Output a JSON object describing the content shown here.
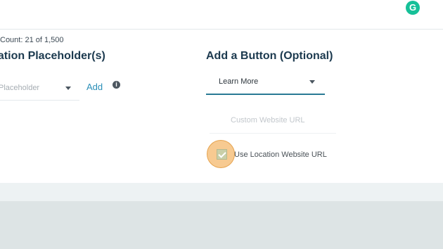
{
  "header": {
    "grammarly_icon": "grammarly-g-icon",
    "grammarly_letter": "G"
  },
  "content": {
    "char_count": "Count: 21 of 1,500",
    "location_title": "cation Placeholder(s)",
    "location_placeholder": "Placeholder",
    "add_label": "Add",
    "info_icon": "info-icon",
    "button_title": "Add a Button (Optional)",
    "button_select_value": "Learn More",
    "url_placeholder": "Custom Website URL",
    "use_location_label": "Use Location Website URL",
    "use_location_checked": true
  },
  "colors": {
    "accent": "#2a7a94",
    "title": "#1c3a4f",
    "link": "#2a8fb8",
    "grammarly": "#16c098",
    "click_highlight": "#f4b86c"
  }
}
